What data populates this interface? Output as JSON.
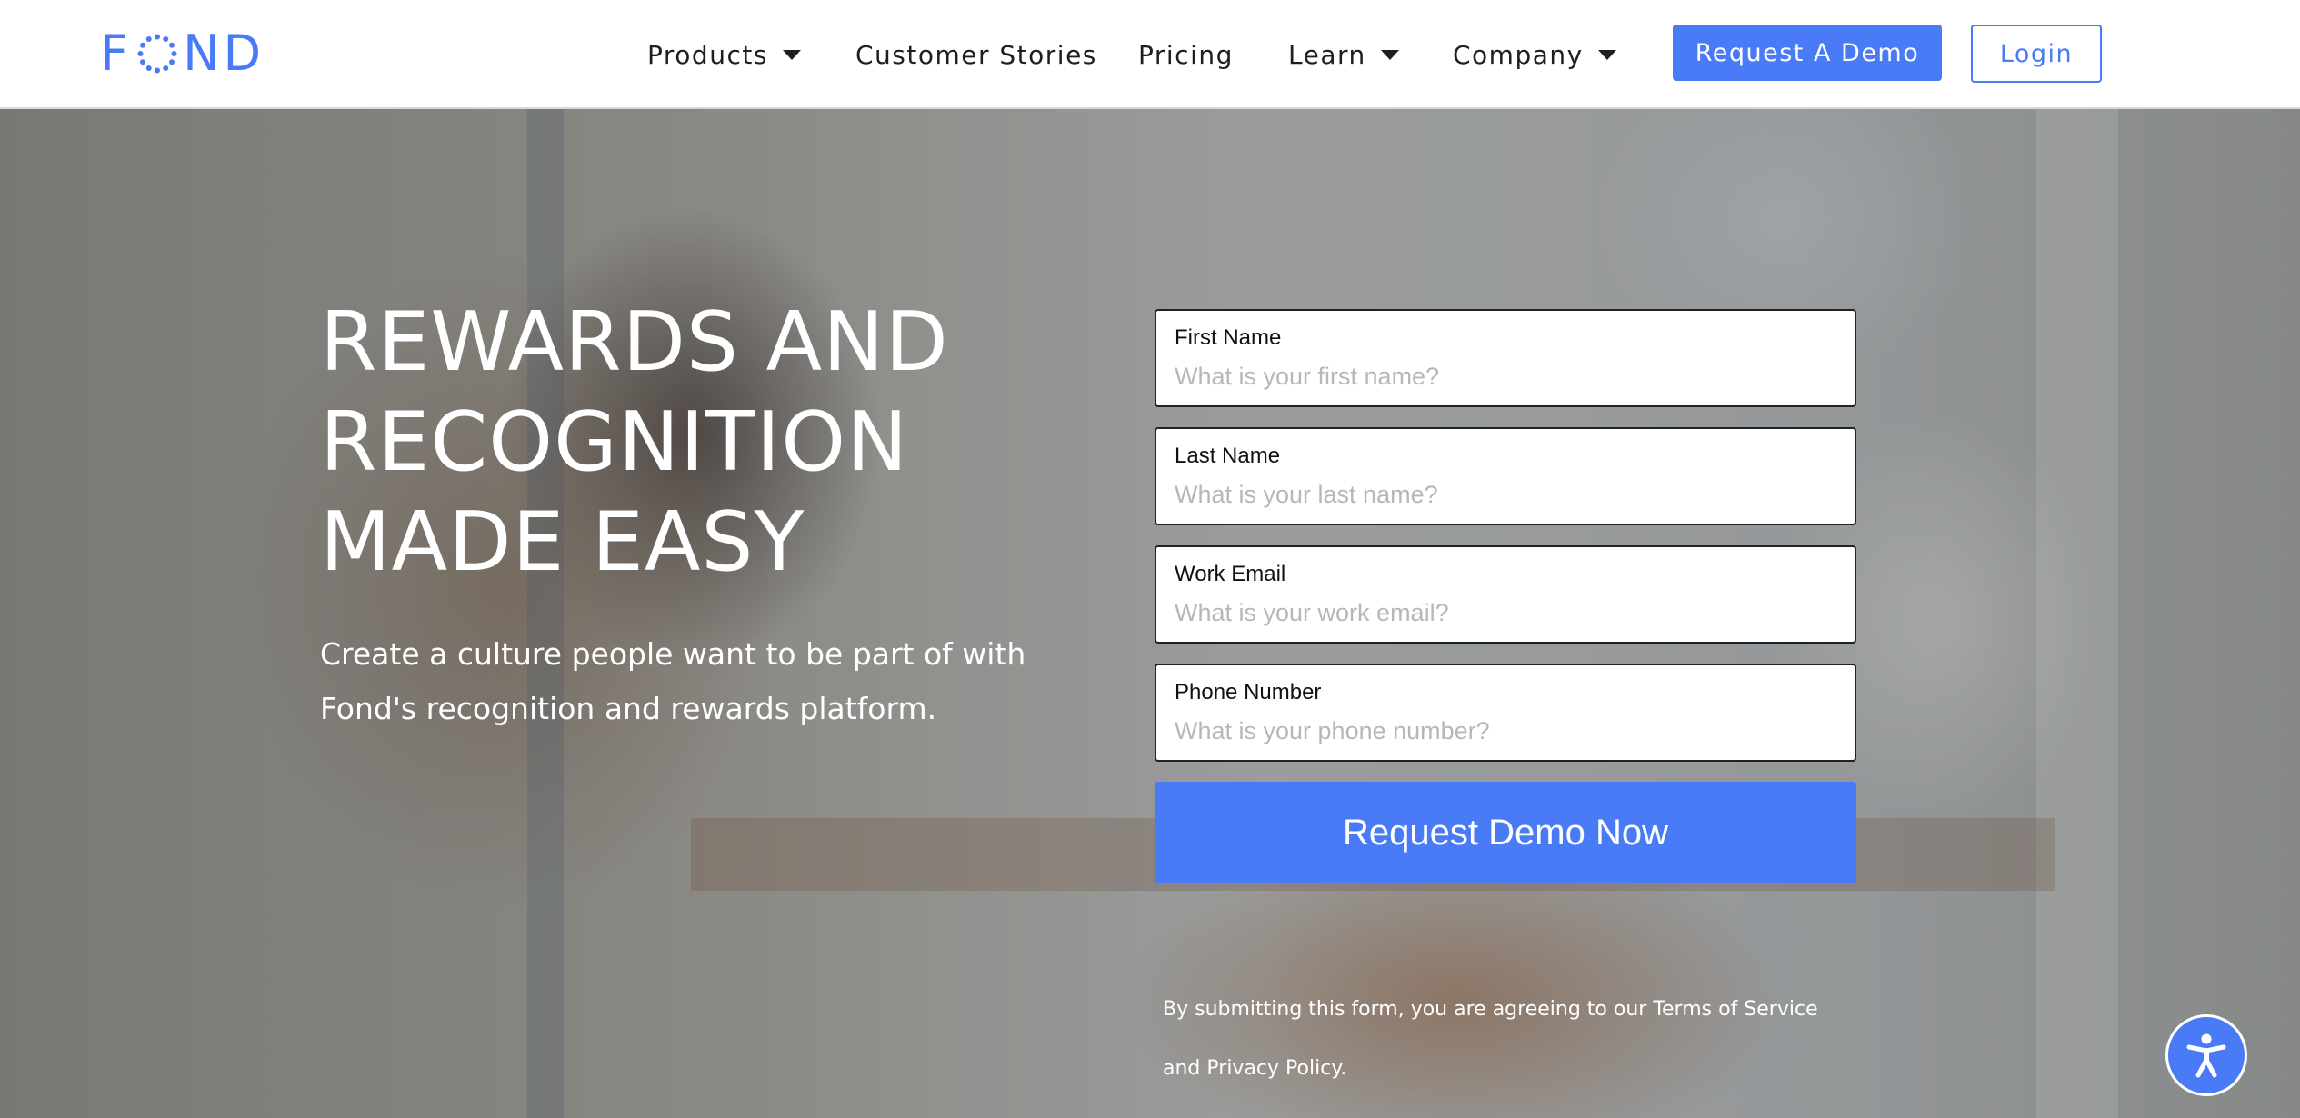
{
  "brand": {
    "logo_left": "F",
    "logo_right": "ND",
    "accent_color": "#4a7bf7"
  },
  "nav": {
    "products": "Products",
    "customer_stories": "Customer Stories",
    "pricing": "Pricing",
    "learn": "Learn",
    "company": "Company",
    "request_demo": "Request A Demo",
    "login": "Login"
  },
  "hero": {
    "headline_line1": "REWARDS AND",
    "headline_line2": "RECOGNITION",
    "headline_line3": "MADE EASY",
    "subtext": "Create a culture people want to be part of with Fond's recognition and rewards platform."
  },
  "form": {
    "first_name": {
      "label": "First Name",
      "placeholder": "What is your first name?"
    },
    "last_name": {
      "label": "Last Name",
      "placeholder": "What is your last name?"
    },
    "work_email": {
      "label": "Work Email",
      "placeholder": "What is your work email?"
    },
    "phone": {
      "label": "Phone Number",
      "placeholder": "What is your phone number?"
    },
    "submit": "Request Demo Now",
    "disclaimer_prefix": "By submitting this form, you are agreeing to our ",
    "terms": "Terms of Service",
    "disclaimer_and": "and ",
    "privacy": "Privacy Policy",
    "disclaimer_end": "."
  },
  "icons": {
    "accessibility": "accessibility-icon",
    "dropdown": "caret-down-icon"
  }
}
